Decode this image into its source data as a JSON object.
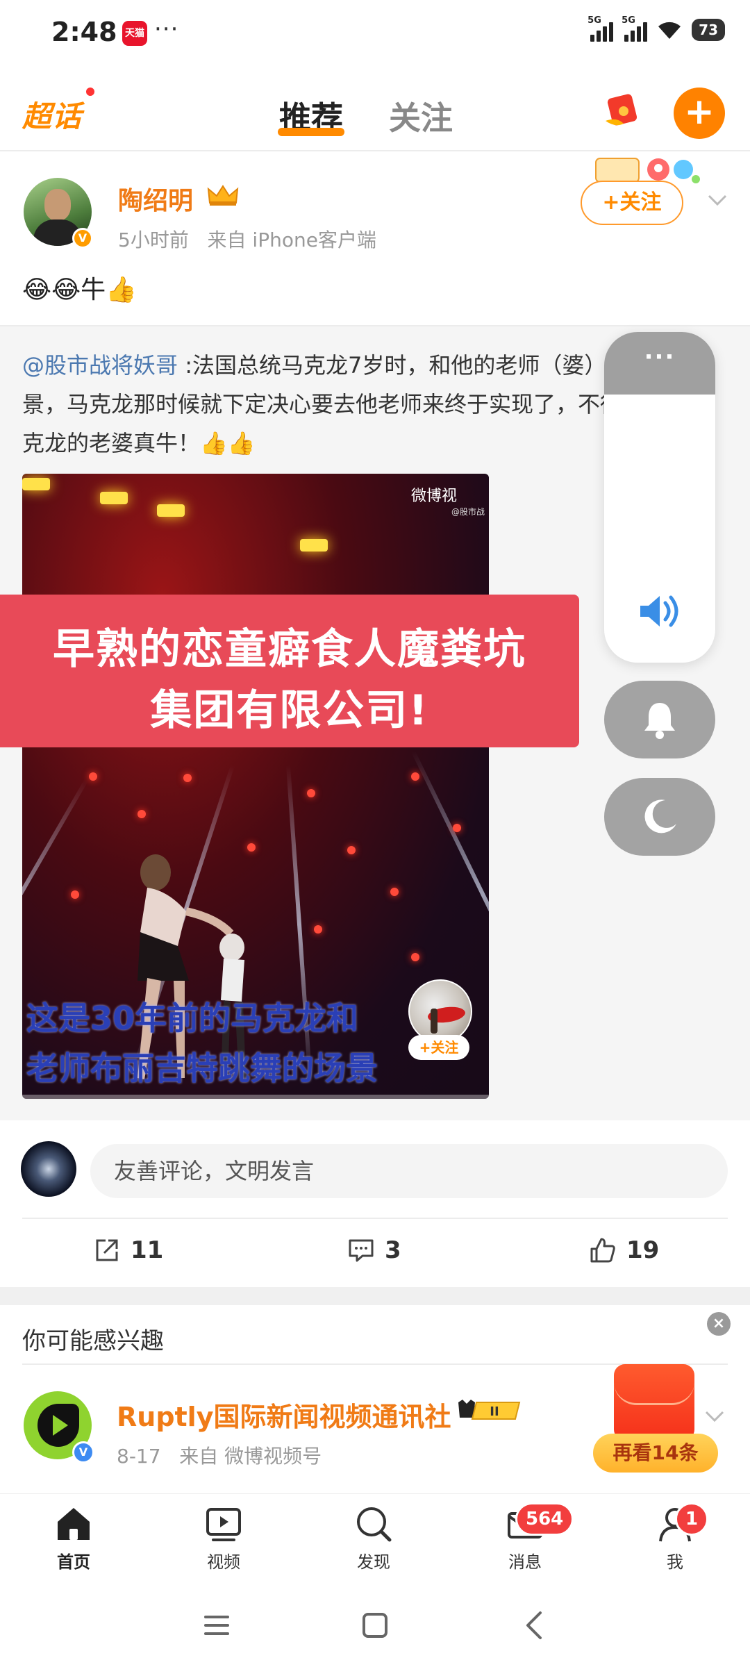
{
  "status_bar": {
    "time": "2:48",
    "app_badge": "天猫",
    "more": "···",
    "sim1": "5G",
    "sim2": "5G",
    "battery": "73"
  },
  "top_nav": {
    "logo": "超话",
    "tabs": [
      {
        "label": "推荐",
        "active": true
      },
      {
        "label": "关注",
        "active": false
      }
    ],
    "plus": "+",
    "accent_color": "#ff8200"
  },
  "post": {
    "author": "陶绍明",
    "time": "5小时前",
    "source": "来自 iPhone客户端",
    "follow_label": "+关注",
    "text": "😂😂牛👍",
    "repost": {
      "mention": "@股市战将妖哥",
      "body": " :法国总统马克龙7岁时，和他的老师（婆）跳舞的场景，马克龙那时候就下定决心要去他老师来终于实现了，不得不说，马克龙的老婆真牛！👍👍",
      "video": {
        "watermark": "微博视",
        "watermark_sub": "@股市战",
        "subtitle_1": "这是30年前的马克龙和",
        "subtitle_2": "老师布丽吉特跳舞的场景",
        "uploader_follow": "+关注"
      }
    },
    "overlay_banner": {
      "line1": "早熟的恋童癖食人魔粪坑",
      "line2": "集团有限公司!",
      "color": "#e84a58"
    },
    "comment_placeholder": "友善评论，文明发言",
    "actions": {
      "share": "11",
      "comment": "3",
      "like": "19"
    }
  },
  "volume_panel": {
    "more": "···",
    "speaker_icon": "speaker-icon",
    "bell_icon": "bell-icon",
    "moon_icon": "moon-icon"
  },
  "recommend": {
    "title": "你可能感兴趣",
    "close": "×",
    "account": {
      "name": "Ruptly国际新闻视频通讯社",
      "level": "II",
      "date": "8-17",
      "source": "来自 微博视频号"
    },
    "float_button": "再看14条"
  },
  "tabbar": {
    "items": [
      {
        "label": "首页",
        "icon": "home-icon"
      },
      {
        "label": "视频",
        "icon": "video-icon"
      },
      {
        "label": "发现",
        "icon": "search-icon"
      },
      {
        "label": "消息",
        "icon": "mail-icon",
        "badge": "564"
      },
      {
        "label": "我",
        "icon": "person-icon",
        "badge": "1"
      }
    ]
  }
}
